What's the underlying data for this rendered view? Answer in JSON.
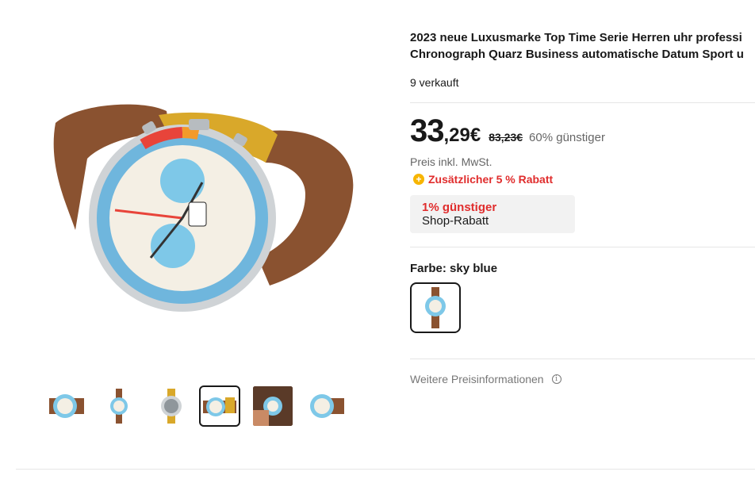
{
  "product": {
    "title_line1": "2023 neue Luxusmarke Top Time Serie Herren uhr professi",
    "title_line2": "Chronograph Quarz Business automatische Datum Sport u",
    "sold": "9 verkauft"
  },
  "price": {
    "main": "33",
    "cents": ",29€",
    "old": "83,23€",
    "discount": "60% günstiger",
    "vat_note": "Preis inkl. MwSt.",
    "coupon_icon": "coin-icon",
    "coupon": "Zusätzlicher 5 % Rabatt"
  },
  "shop_discount": {
    "percent": "1% günstiger",
    "label": "Shop-Rabatt"
  },
  "variant": {
    "label": "Farbe: sky blue"
  },
  "more_price_info": "Weitere Preisinformationen",
  "gallery": {
    "thumbs": [
      "watch-angle",
      "watch-front",
      "watch-back",
      "watch-strap",
      "watch-wrist",
      "watch-side"
    ],
    "active_index": 3
  },
  "colors": {
    "accent_red": "#e02d2d",
    "coin": "#f7b500",
    "dial_blue": "#7ec8e8",
    "leather": "#8a5230"
  }
}
